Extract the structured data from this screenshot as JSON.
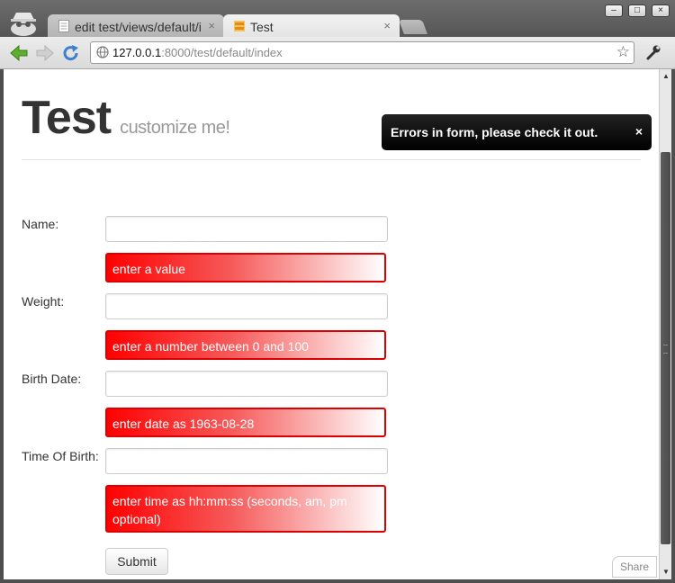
{
  "browser": {
    "tabs": [
      {
        "label": "edit test/views/default/inde",
        "active": false
      },
      {
        "label": "Test",
        "active": true
      }
    ],
    "tab_close_glyph": "×",
    "url_host": "127.0.0.1",
    "url_rest": ":8000/test/default/index",
    "window_controls": {
      "minimize": "–",
      "maximize": "□",
      "close": "×"
    }
  },
  "page": {
    "title": "Test",
    "subtitle": "customize me!",
    "flash_message": "Errors in form, please check it out.",
    "flash_close": "×",
    "form": {
      "fields": [
        {
          "label": "Name:",
          "value": "",
          "error": "enter a value"
        },
        {
          "label": "Weight:",
          "value": "",
          "error": "enter a number between 0 and 100"
        },
        {
          "label": "Birth Date:",
          "value": "",
          "error": "enter date as 1963-08-28"
        },
        {
          "label": "Time Of Birth:",
          "value": "",
          "error": "enter time as hh:mm:ss (seconds, am, pm optional)"
        }
      ],
      "submit_label": "Submit"
    },
    "share_label": "Share"
  },
  "colors": {
    "error_red": "#ff0000",
    "error_border": "#dd0000",
    "flash_bg": "#111111",
    "title_gray": "#333333",
    "subtitle_gray": "#999999"
  }
}
